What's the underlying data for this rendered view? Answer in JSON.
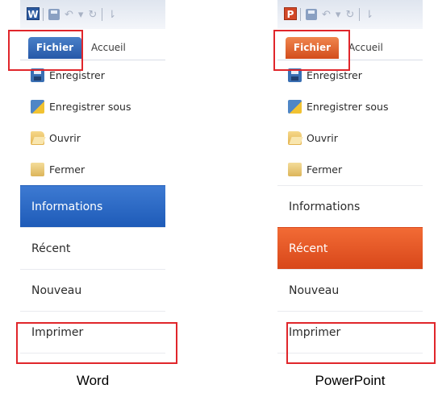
{
  "panels": [
    {
      "app": "Word",
      "app_icon_letter": "W",
      "tabs": {
        "file": "Fichier",
        "home": "Accueil"
      },
      "commands": [
        "Enregistrer",
        "Enregistrer sous",
        "Ouvrir",
        "Fermer"
      ],
      "sections": [
        "Informations",
        "Récent",
        "Nouveau",
        "Imprimer"
      ],
      "active_section": "Informations",
      "accent": "#2b5fb8",
      "caption": "Word"
    },
    {
      "app": "PowerPoint",
      "app_icon_letter": "P",
      "tabs": {
        "file": "Fichier",
        "home": "Accueil"
      },
      "commands": [
        "Enregistrer",
        "Enregistrer sous",
        "Ouvrir",
        "Fermer"
      ],
      "sections": [
        "Informations",
        "Récent",
        "Nouveau",
        "Imprimer"
      ],
      "active_section": "Récent",
      "accent": "#e0551f",
      "caption": "PowerPoint"
    }
  ],
  "highlight_color": "#e0262b",
  "qat_glyphs": {
    "undo": "↶",
    "redo": "↻",
    "customize": "⇂"
  }
}
